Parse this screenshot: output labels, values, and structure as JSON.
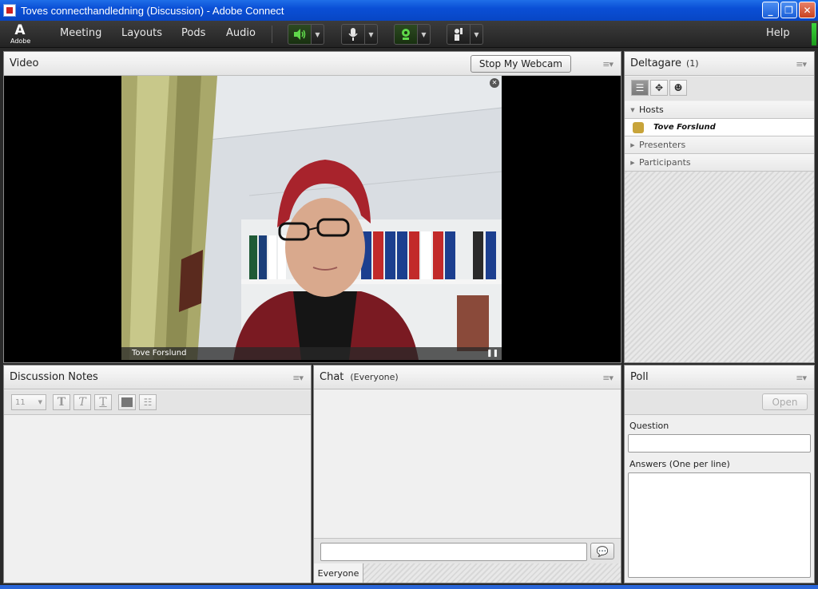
{
  "window": {
    "title": "Toves connecthandledning (Discussion) - Adobe Connect"
  },
  "logo": {
    "mark": "A",
    "text": "Adobe"
  },
  "menu": [
    "Meeting",
    "Layouts",
    "Pods",
    "Audio"
  ],
  "help_label": "Help",
  "toolbar_icons": [
    "speaker-icon",
    "microphone-icon",
    "webcam-icon",
    "raise-hand-icon"
  ],
  "video_pod": {
    "title": "Video",
    "stop_webcam_label": "Stop My Webcam",
    "presenter_name": "Tove Forslund"
  },
  "attendees_pod": {
    "title": "Deltagare",
    "count": "(1)",
    "sections": {
      "hosts": "Hosts",
      "presenters": "Presenters",
      "participants": "Participants"
    },
    "host_name": "Tove Forslund"
  },
  "notes_pod": {
    "title": "Discussion Notes",
    "font_size": "11"
  },
  "chat_pod": {
    "title": "Chat",
    "scope": "(Everyone)",
    "tab_label": "Everyone",
    "message_placeholder": ""
  },
  "poll_pod": {
    "title": "Poll",
    "open_label": "Open",
    "question_label": "Question",
    "answers_label": "Answers (One per line)"
  },
  "colors": {
    "titlebar": "#0a4fd6",
    "status_green": "#3cd43c"
  }
}
